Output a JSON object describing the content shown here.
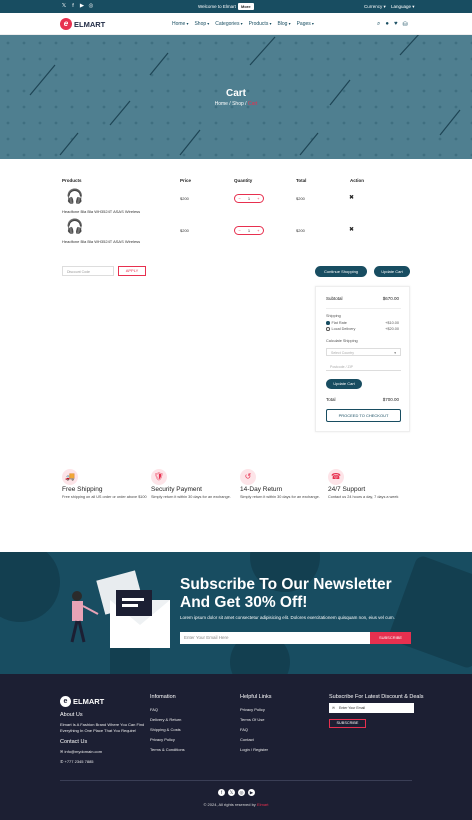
{
  "topbar": {
    "social": [
      "x-icon",
      "facebook-icon",
      "youtube-icon",
      "instagram-icon"
    ],
    "welcome": "Welcome to Elmart",
    "more": "More",
    "currency": "Currency",
    "language": "Language"
  },
  "header": {
    "logo": "ELMART",
    "nav": [
      "Home",
      "Shop",
      "Categories",
      "Products",
      "Blog",
      "Pages"
    ],
    "icons": [
      "search-icon",
      "user-icon",
      "heart-icon",
      "bag-icon"
    ]
  },
  "banner": {
    "title": "Cart",
    "crumb_home": "Home",
    "crumb_shop": "Shop",
    "crumb_current": "Cart"
  },
  "table": {
    "headers": [
      "Products",
      "Price",
      "Quantity",
      "Total",
      "Action"
    ],
    "rows": [
      {
        "name": "Headfone Bla Bla WH3524T ASAS Wireless",
        "price": "$200",
        "qty": "1",
        "total": "$200"
      },
      {
        "name": "Headfone Bla Bla WH3524T ASAS Wireless",
        "price": "$200",
        "qty": "1",
        "total": "$200"
      }
    ]
  },
  "coupon": {
    "placeholder": "Discount Code",
    "apply": "APPLY"
  },
  "buttons": {
    "continue": "Continue Shopping",
    "update": "Update Cart"
  },
  "totals": {
    "subtotal_label": "Subtotal",
    "subtotal_value": "$670.00",
    "shipping_label": "Shipping",
    "flat_rate": "Flat Rate",
    "flat_rate_value": "+$10.00",
    "local_delivery": "Local Delivery",
    "local_delivery_value": "+$20.00",
    "calculate": "Calculate Shipping",
    "country_placeholder": "Select Country",
    "postcode_placeholder": "Postcode / ZIP",
    "update": "Update Cart",
    "total_label": "Total",
    "total_value": "$700.00",
    "checkout": "PROCEED TO CHECKOUT"
  },
  "features": [
    {
      "icon": "truck-icon",
      "title": "Free Shipping",
      "desc": "Free shipping on all US order or order above $100"
    },
    {
      "icon": "shield-icon",
      "title": "Security Payment",
      "desc": "Simply return it within 30 days for an exchange."
    },
    {
      "icon": "return-icon",
      "title": "14-Day Return",
      "desc": "Simply return it within 30 days for an exchange."
    },
    {
      "icon": "headset-icon",
      "title": "24/7 Support",
      "desc": "Contact us 24 hours a day, 7 days a week"
    }
  ],
  "newsletter": {
    "title_1": "Subscribe To Our Newsletter",
    "title_2": "And Get 30% Off!",
    "text": "Lorem ipsum dolor sit amet consectetur adipisicing elit. Dolores exercitationem quisquam non, eius vel cum.",
    "placeholder": "Enter Your Email Here",
    "button": "SUBSCRIBE"
  },
  "footer": {
    "logo": "ELMART",
    "about_title": "About Us",
    "about_text": "Elmart Is A Fashion Brand Where You Can Find Everything In One Place That You Require!",
    "contact_title": "Contact Us",
    "email": "info@mydomain.com",
    "phone": "+777 2345 7885",
    "info_title": "Infomation",
    "info_links": [
      "FAQ",
      "Delivery & Return",
      "Shipping & Costs",
      "Privacy Policy",
      "Terms & Conditions"
    ],
    "help_title": "Helpful Links",
    "help_links": [
      "Privacy Policy",
      "Terms Of Use",
      "FAQ",
      "Contact",
      "Login / Register"
    ],
    "sub_title": "Subscribe For Latest Discount & Deals",
    "sub_placeholder": "Enter Your Email",
    "sub_button": "SUBSCRIBE",
    "copyright": "© 2024, All rights reserved by",
    "brand": "Elmart"
  },
  "colors": {
    "primary": "#184d61",
    "accent": "#e7304f",
    "footer": "#1c1f33"
  }
}
